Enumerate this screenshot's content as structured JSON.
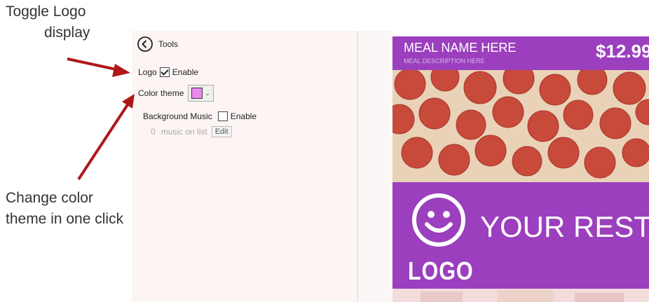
{
  "annotations": {
    "logo_line1": "Toggle Logo",
    "logo_line2": "display",
    "color_line1": "Change color",
    "color_line2": "theme in one click"
  },
  "tools": {
    "title": "Tools",
    "logo_label": "Logo",
    "logo_enable_label": "Enable",
    "logo_enabled": true,
    "color_theme_label": "Color theme",
    "color_theme_value": "#ee88ee",
    "background_music_label": "Background Music",
    "music_enable_label": "Enable",
    "music_enabled": false,
    "music_count": "0",
    "music_count_suffix": "music on list",
    "edit_label": "Edit"
  },
  "menu": {
    "meal_name": "MEAL NAME HERE",
    "meal_description": "MEAL DESCRIPTION HERE",
    "price": "$12.99",
    "restaurant_name": "YOUR REST",
    "logo_text": "LOGO",
    "theme_color": "#9b3fbe"
  }
}
